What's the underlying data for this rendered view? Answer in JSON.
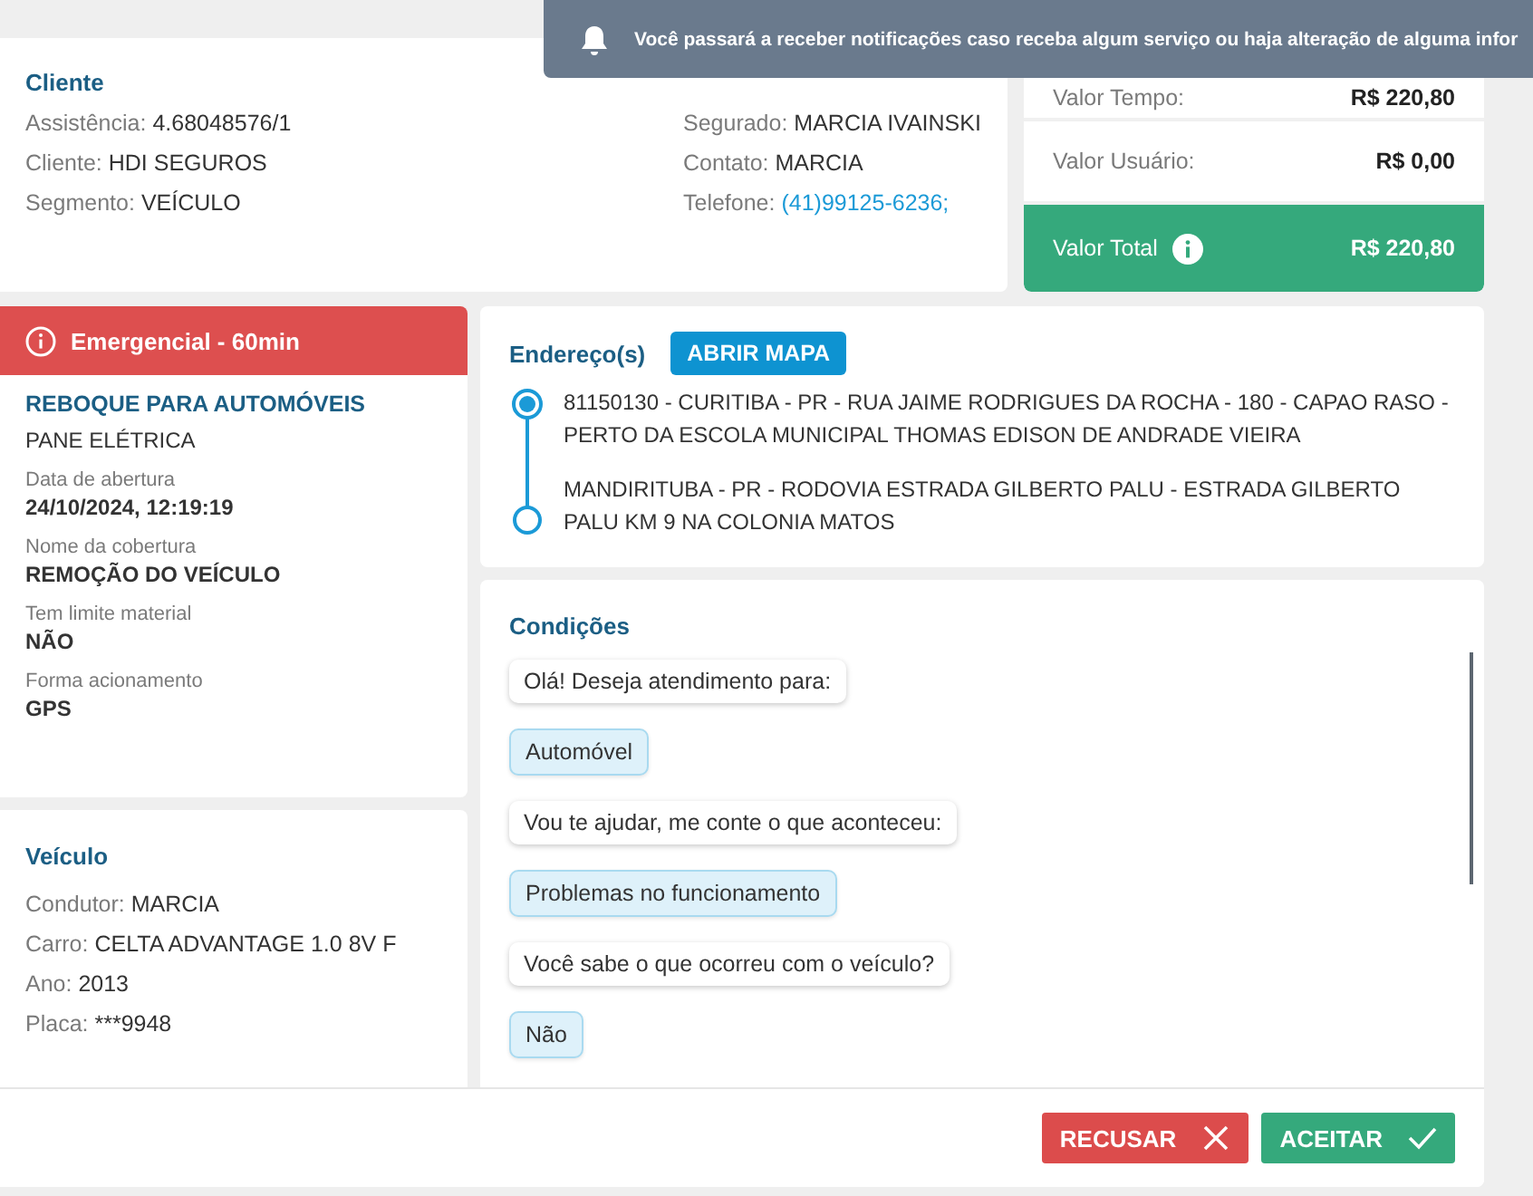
{
  "notification": {
    "text": "Você passará a receber notificações caso receba algum serviço ou haja alteração de alguma infor"
  },
  "client": {
    "title": "Cliente",
    "left": [
      {
        "label": "Assistência:",
        "value": "4.68048576/1",
        "kind": "text"
      },
      {
        "label": "Cliente:",
        "value": "HDI SEGUROS",
        "kind": "text"
      },
      {
        "label": "Segmento:",
        "value": "VEÍCULO",
        "kind": "text"
      }
    ],
    "right": [
      {
        "label": "Segurado:",
        "value": "MARCIA IVAINSKI",
        "kind": "text"
      },
      {
        "label": "Contato:",
        "value": "MARCIA",
        "kind": "text"
      },
      {
        "label": "Telefone:",
        "value": "(41)99125-6236;",
        "kind": "link"
      }
    ]
  },
  "values": [
    {
      "label": "Valor Tempo:",
      "value": "R$ 220,80",
      "kind": "plain"
    },
    {
      "label": "Valor Usuário:",
      "value": "R$ 0,00",
      "kind": "plain"
    },
    {
      "label": "Valor Total",
      "value": "R$ 220,80",
      "kind": "total"
    }
  ],
  "service": {
    "priority": "Emergencial - 60min",
    "title": "REBOQUE PARA AUTOMÓVEIS",
    "subtitle": "PANE ELÉTRICA",
    "fields": [
      {
        "label": "Data de abertura",
        "value": "24/10/2024, 12:19:19"
      },
      {
        "label": "Nome da cobertura",
        "value": "REMOÇÃO DO VEÍCULO"
      },
      {
        "label": "Tem limite material",
        "value": "NÃO"
      },
      {
        "label": "Forma acionamento",
        "value": "GPS"
      }
    ]
  },
  "vehicle": {
    "title": "Veículo",
    "fields": [
      {
        "label": "Condutor:",
        "value": "MARCIA"
      },
      {
        "label": "Carro:",
        "value": "CELTA ADVANTAGE 1.0 8V F"
      },
      {
        "label": "Ano:",
        "value": "2013"
      },
      {
        "label": "Placa:",
        "value": "***9948"
      }
    ]
  },
  "addresses": {
    "title": "Endereço(s)",
    "map_button": "ABRIR MAPA",
    "items": [
      {
        "text": "81150130 - CURITIBA - PR - RUA JAIME RODRIGUES DA ROCHA - 180 - CAPAO RASO - PERTO DA ESCOLA MUNICIPAL THOMAS EDISON DE ANDRADE VIEIRA",
        "kind": "origin"
      },
      {
        "text": "MANDIRITUBA - PR - RODOVIA ESTRADA GILBERTO PALU - ESTRADA GILBERTO PALU KM 9 NA COLONIA MATOS",
        "kind": "destination"
      }
    ]
  },
  "conditions": {
    "title": "Condições",
    "messages": [
      {
        "text": "Olá! Deseja atendimento para:",
        "kind": "question"
      },
      {
        "text": "Automóvel",
        "kind": "answer"
      },
      {
        "text": "Vou te ajudar, me conte o que aconteceu:",
        "kind": "question"
      },
      {
        "text": "Problemas no funcionamento",
        "kind": "answer"
      },
      {
        "text": "Você sabe o que ocorreu com o veículo?",
        "kind": "question"
      },
      {
        "text": "Não",
        "kind": "answer"
      }
    ]
  },
  "actions": [
    {
      "label": "RECUSAR",
      "kind": "reject"
    },
    {
      "label": "ACEITAR",
      "kind": "accept"
    }
  ]
}
